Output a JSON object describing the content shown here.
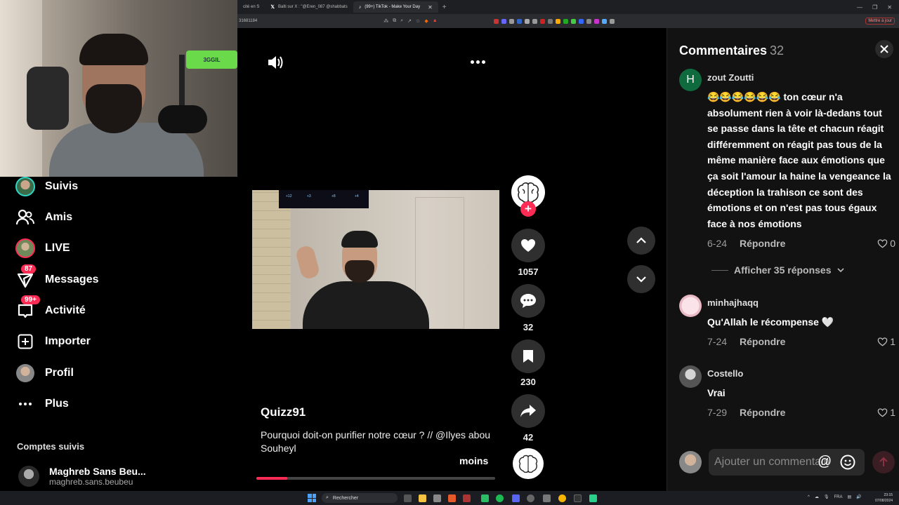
{
  "browser": {
    "tabs": [
      {
        "label": "cité en S",
        "active": false
      },
      {
        "label": "Balti sur X : \"@Eren_087 @shabbats",
        "active": false
      },
      {
        "label": "(99+) TikTok - Make Your Day",
        "active": true
      }
    ],
    "address_fragment": "31681184",
    "update_button": "Mettre à jour"
  },
  "webcam": {
    "screen_text": "3GGIL"
  },
  "nav": {
    "items": [
      {
        "label": "Suivis",
        "icon": "following-avatar-icon"
      },
      {
        "label": "Amis",
        "icon": "friends-icon"
      },
      {
        "label": "LIVE",
        "icon": "live-avatar-icon"
      },
      {
        "label": "Messages",
        "icon": "messages-icon",
        "badge": "87"
      },
      {
        "label": "Activité",
        "icon": "activity-icon",
        "badge": "99+"
      },
      {
        "label": "Importer",
        "icon": "upload-icon"
      },
      {
        "label": "Profil",
        "icon": "profile-avatar-icon"
      },
      {
        "label": "Plus",
        "icon": "more-icon"
      }
    ],
    "followed_title": "Comptes suivis",
    "followed": [
      {
        "name": "Maghreb Sans Beu...",
        "handle": "maghreb.sans.beubeu"
      }
    ]
  },
  "video": {
    "author": "Quizz91",
    "description": "Pourquoi doit-on purifier notre cœur ? // @Ilyes abou Souheyl",
    "less_label": "moins",
    "progress": 0.13,
    "tv_scores": [
      "+12",
      "+3",
      "+8",
      "+4"
    ]
  },
  "actions": {
    "likes": "1057",
    "comments": "32",
    "saves": "230",
    "shares": "42"
  },
  "comments_panel": {
    "title": "Commentaires",
    "count": "32",
    "input_placeholder": "Ajouter un commentaire...",
    "show_replies": "Afficher 35 réponses",
    "reply_label": "Répondre",
    "items": [
      {
        "user": "zout Zoutti",
        "avatar_letter": "H",
        "text": "😂😂😂😂😂😂 ton cœur n'a absolument rien à voir là-dedans tout se passe dans la tête et chacun réagit différemment on réagit pas tous de la même manière face aux émotions que ça soit l'amour la haine la vengeance la déception la trahison ce sont des émotions et on n'est pas tous égaux face à nos émotions",
        "date": "6-24",
        "likes": "0"
      },
      {
        "user": "minhajhaqq",
        "text": "Qu'Allah le récompense 🤍",
        "date": "7-24",
        "likes": "1"
      },
      {
        "user": "Costello",
        "text": "Vrai",
        "date": "7-29",
        "likes": "1"
      }
    ]
  },
  "taskbar": {
    "search_label": "Rechercher",
    "lang": "FRA",
    "time": "23:15",
    "date": "07/08/2024"
  }
}
